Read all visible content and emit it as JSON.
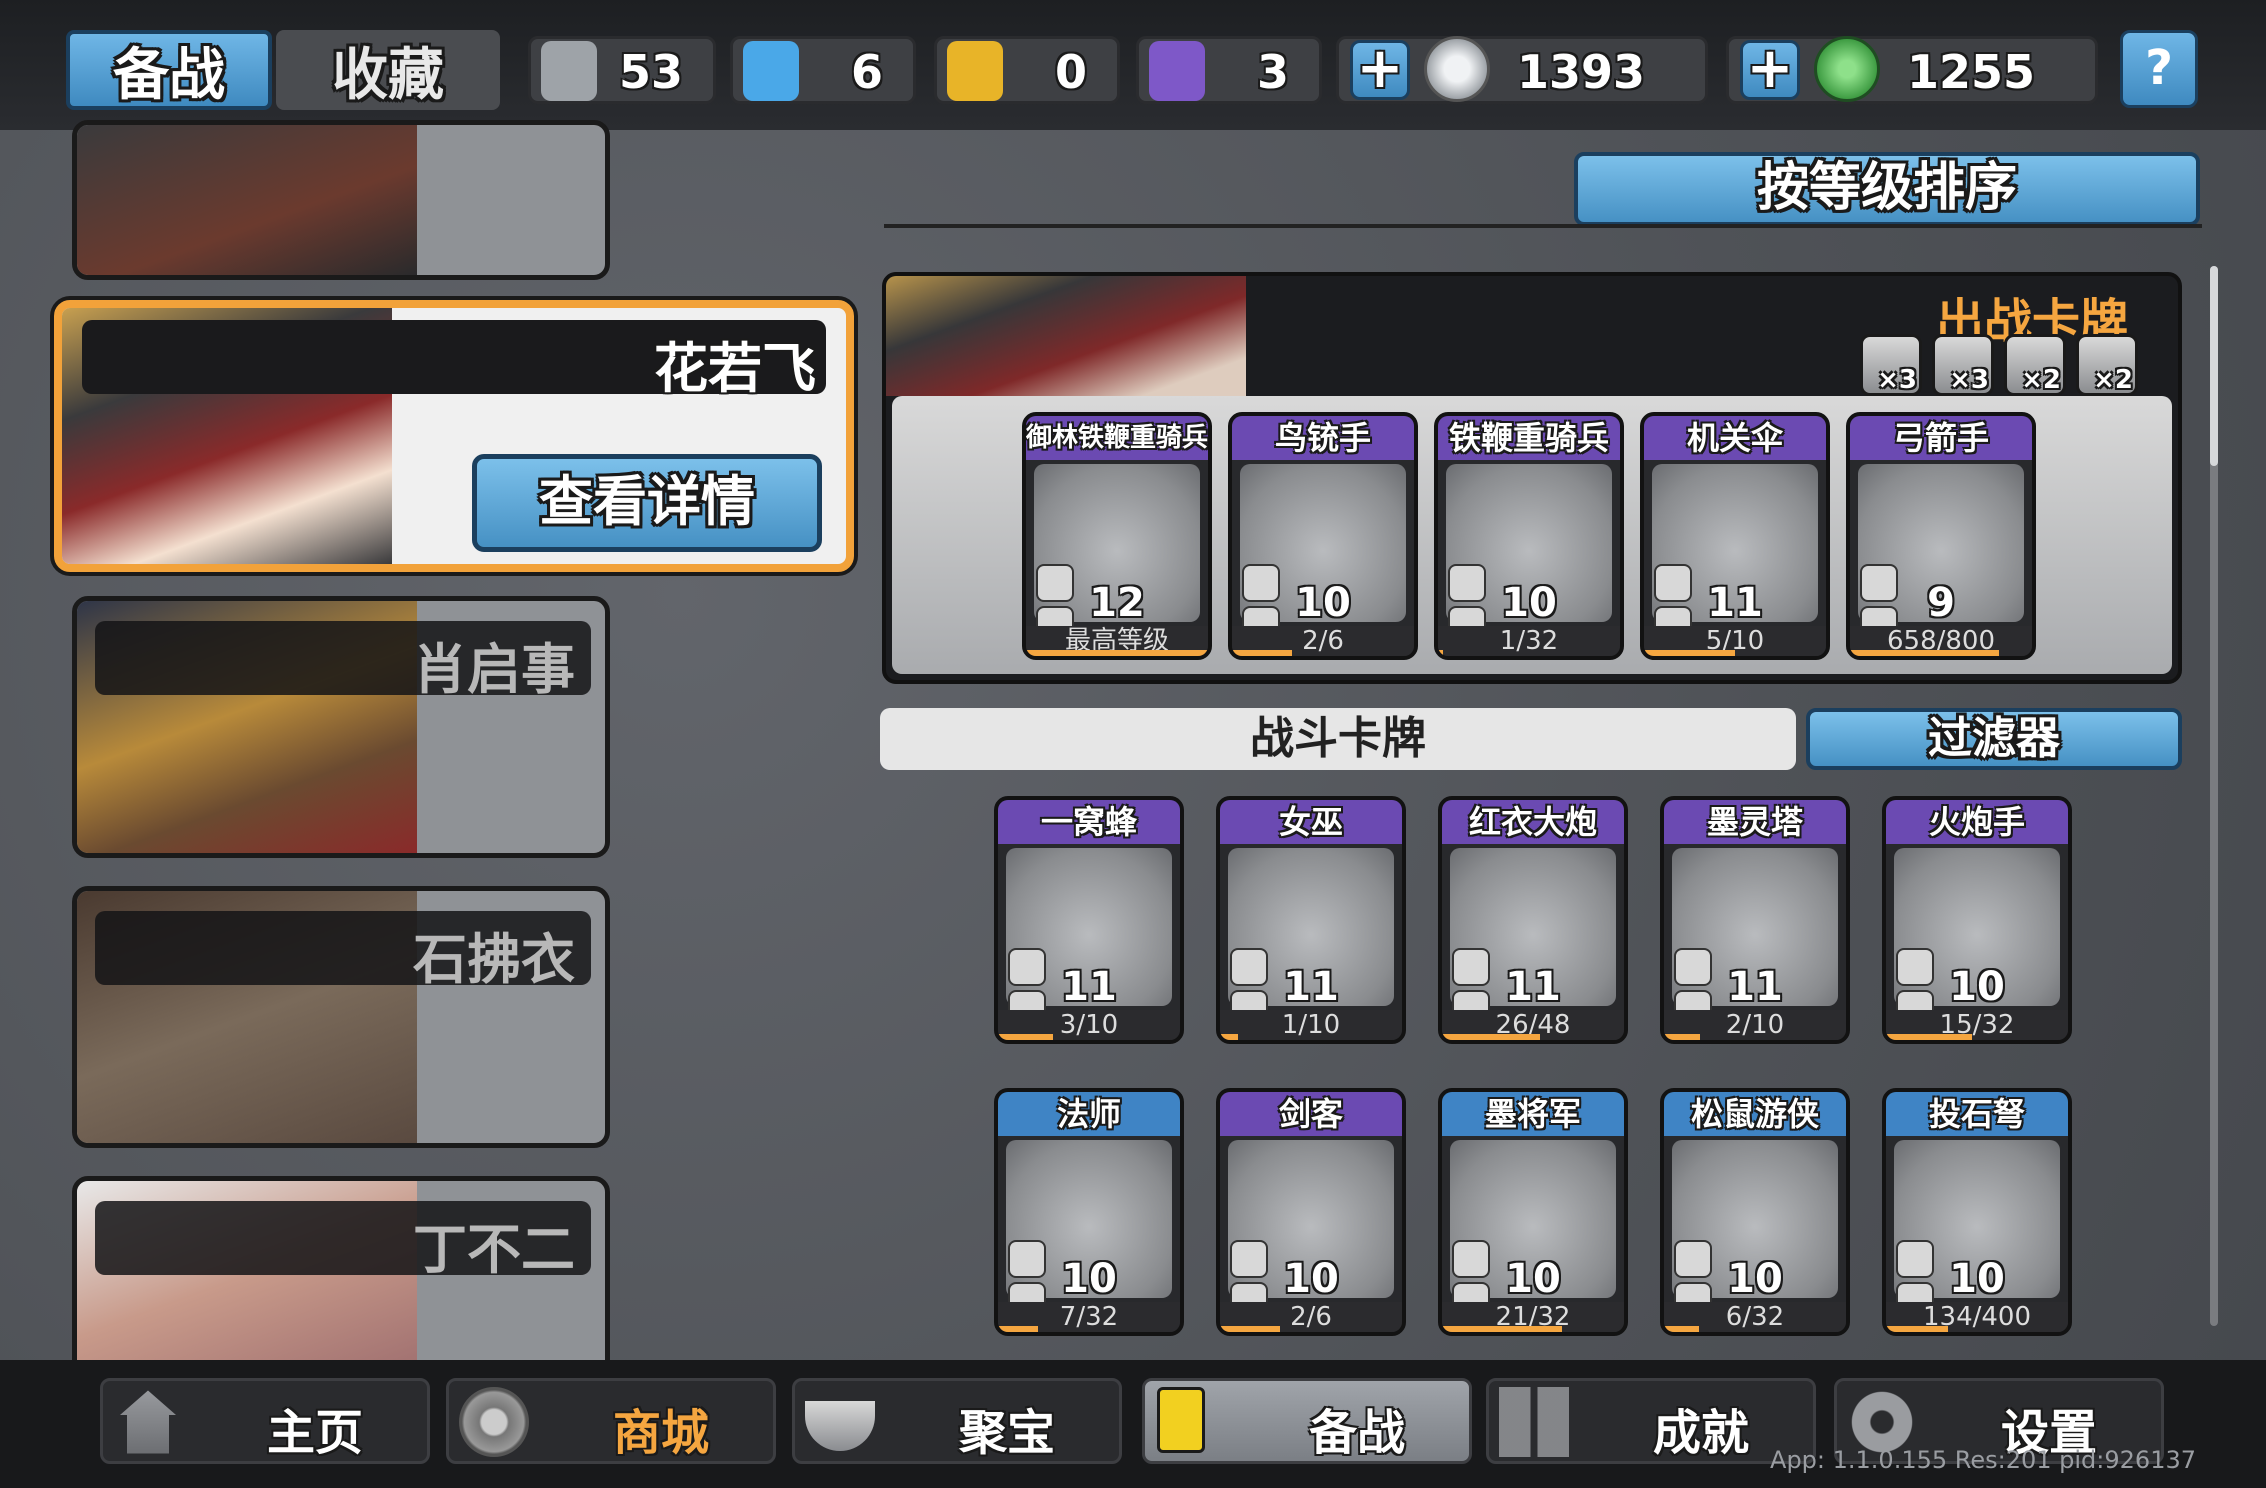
{
  "tabs": {
    "prepare": "备战",
    "collection": "收藏"
  },
  "resources": [
    {
      "name": "silver-shield",
      "value": "53",
      "color": "#9ea3a8"
    },
    {
      "name": "blue-crystal",
      "value": "6",
      "color": "#4aa8e8"
    },
    {
      "name": "gold-shield",
      "value": "0",
      "color": "#e8b428"
    },
    {
      "name": "purple-badge",
      "value": "3",
      "color": "#7e58c8"
    }
  ],
  "currency": [
    {
      "name": "silver-coin",
      "value": "1393",
      "color": "#c8ccd0"
    },
    {
      "name": "jade-coin",
      "value": "1255",
      "color": "#46b04a"
    }
  ],
  "help_icon": "help-icon",
  "sort_button": "按等级排序",
  "heroes": [
    {
      "name": ""
    },
    {
      "name": "花若飞",
      "details_button": "查看详情"
    },
    {
      "name": "肖启事"
    },
    {
      "name": "石拂衣"
    },
    {
      "name": "丁不二"
    }
  ],
  "deck": {
    "title": "出战卡牌",
    "badges": [
      {
        "icon": "shield-icon",
        "count": "×3"
      },
      {
        "icon": "arrows-icon",
        "count": "×3"
      },
      {
        "icon": "horse-icon",
        "count": "×2"
      },
      {
        "icon": "helmet-icon",
        "count": "×2"
      }
    ],
    "cards": [
      {
        "name": "御林铁鞭重骑兵",
        "level": "12",
        "progress": "最高等级",
        "fill": 1.0,
        "color": "#6b4ab2"
      },
      {
        "name": "鸟铳手",
        "level": "10",
        "progress": "2/6",
        "fill": 0.33,
        "color": "#6b4ab2"
      },
      {
        "name": "铁鞭重骑兵",
        "level": "10",
        "progress": "1/32",
        "fill": 0.03,
        "color": "#6b4ab2"
      },
      {
        "name": "机关伞",
        "level": "11",
        "progress": "5/10",
        "fill": 0.5,
        "color": "#6b4ab2"
      },
      {
        "name": "弓箭手",
        "level": "9",
        "progress": "658/800",
        "fill": 0.82,
        "color": "#6b4ab2"
      }
    ]
  },
  "battle_cards_label": "战斗卡牌",
  "filter_button": "过滤器",
  "battle_cards": [
    {
      "name": "一窝蜂",
      "level": "11",
      "progress": "3/10",
      "fill": 0.3,
      "color": "#6b4ab2"
    },
    {
      "name": "女巫",
      "level": "11",
      "progress": "1/10",
      "fill": 0.1,
      "color": "#6b4ab2"
    },
    {
      "name": "红衣大炮",
      "level": "11",
      "progress": "26/48",
      "fill": 0.54,
      "color": "#6b4ab2"
    },
    {
      "name": "墨灵塔",
      "level": "11",
      "progress": "2/10",
      "fill": 0.2,
      "color": "#6b4ab2"
    },
    {
      "name": "火炮手",
      "level": "10",
      "progress": "15/32",
      "fill": 0.47,
      "color": "#6b4ab2"
    },
    {
      "name": "法师",
      "level": "10",
      "progress": "7/32",
      "fill": 0.22,
      "color": "#3f84c5"
    },
    {
      "name": "剑客",
      "level": "10",
      "progress": "2/6",
      "fill": 0.33,
      "color": "#6b4ab2"
    },
    {
      "name": "墨将军",
      "level": "10",
      "progress": "21/32",
      "fill": 0.66,
      "color": "#3f84c5"
    },
    {
      "name": "松鼠游侠",
      "level": "10",
      "progress": "6/32",
      "fill": 0.19,
      "color": "#3f84c5"
    },
    {
      "name": "投石弩",
      "level": "10",
      "progress": "134/400",
      "fill": 0.34,
      "color": "#3f84c5"
    }
  ],
  "nav": [
    {
      "label": "主页",
      "icon": "pagoda-icon"
    },
    {
      "label": "商城",
      "icon": "coins-icon"
    },
    {
      "label": "聚宝",
      "icon": "treasure-bowl-icon"
    },
    {
      "label": "备战",
      "icon": "cards-icon"
    },
    {
      "label": "成就",
      "icon": "achievements-icon"
    },
    {
      "label": "设置",
      "icon": "gear-icon"
    }
  ],
  "version": "App: 1.1.0.155 Res:201 pid:926137"
}
